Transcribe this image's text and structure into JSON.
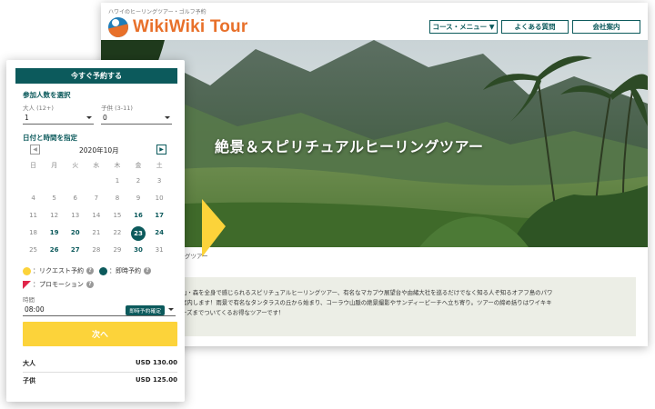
{
  "site": {
    "tagline": "ハワイのヒーリングツアー・ゴルフ予約",
    "logo_text": "WikiWiki Tour",
    "nav": [
      {
        "label": "コース・メニュー ▼"
      },
      {
        "label": "よくある質問"
      },
      {
        "label": "会社案内"
      }
    ],
    "hero_title": "絶景＆スピリチュアルヒーリングツアー",
    "breadcrumb": "グツアー",
    "description_lines": [
      "山・森を全身で感じられるスピリチュアルヒーリングツアー、有名なマカプウ展望台や由緒大社を巡るだけでなく知る人ぞ知るオアフ島のパワ",
      "案内します！雨景で有名なタンタラスの丘から始まり、コーラウ山脈の絶景撮影やサンディービーチへ立ち寄り。ツアーの締め括りはワイキキ",
      "ーズまでついてくるお得なツアーです！"
    ]
  },
  "booking": {
    "header": "今すぐ予約する",
    "participants_title": "参加人数を選択",
    "adult_label": "大人 (12+)",
    "adult_value": "1",
    "child_label": "子供 (3-11)",
    "child_value": "0",
    "datetime_title": "日付と時間を指定",
    "calendar": {
      "prev_icon": "◀",
      "next_icon": "▶",
      "month_label": "2020年10月",
      "weekdays": [
        "日",
        "月",
        "火",
        "水",
        "木",
        "金",
        "土"
      ],
      "weeks": [
        [
          "",
          "",
          "",
          "",
          "1",
          "2",
          "3"
        ],
        [
          "4",
          "5",
          "6",
          "7",
          "8",
          "9",
          "10"
        ],
        [
          "11",
          "12",
          "13",
          "14",
          "15",
          "16",
          "17"
        ],
        [
          "18",
          "19",
          "20",
          "21",
          "22",
          "23",
          "24"
        ],
        [
          "25",
          "26",
          "27",
          "28",
          "29",
          "30",
          "31"
        ]
      ],
      "available_days": [
        "16",
        "17",
        "19",
        "20",
        "23",
        "24",
        "26",
        "27",
        "30"
      ],
      "selected_day": "23"
    },
    "legend": {
      "request": "：リクエスト予約",
      "instant": "：即時予約",
      "promotion": "：プロモーション",
      "help_glyph": "?"
    },
    "time_label": "時間",
    "time_value": "08:00",
    "instant_badge": "即時予約確定",
    "next_button": "次へ",
    "prices": [
      {
        "label": "大人",
        "value": "USD 130.00"
      },
      {
        "label": "子供",
        "value": "USD 125.00"
      }
    ]
  },
  "colors": {
    "brand_teal": "#0c5a5c",
    "accent_orange": "#e8702a",
    "request_yellow": "#fcd33a",
    "promo_red": "#e0264a"
  }
}
